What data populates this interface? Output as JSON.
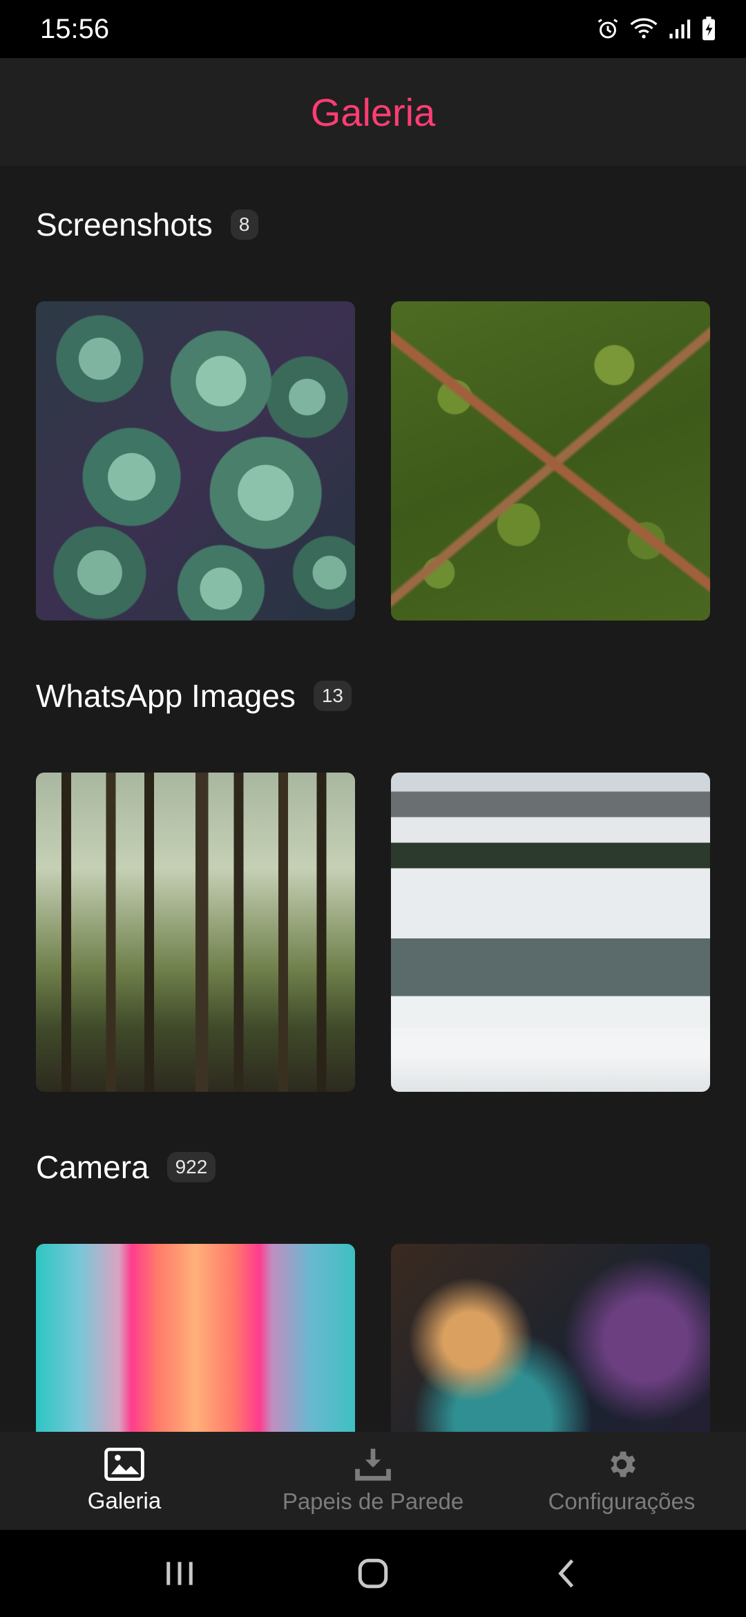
{
  "status_bar": {
    "time": "15:56",
    "icons": [
      "alarm-icon",
      "wifi-icon",
      "signal-icon",
      "battery-charging-icon"
    ]
  },
  "app_bar": {
    "title": "Galeria"
  },
  "sections": [
    {
      "title": "Screenshots",
      "count": "8",
      "thumbnails": [
        "succulents-photo",
        "aerial-forest-photo"
      ]
    },
    {
      "title": "WhatsApp Images",
      "count": "13",
      "thumbnails": [
        "forest-trees-photo",
        "mountain-lake-photo"
      ]
    },
    {
      "title": "Camera",
      "count": "922",
      "thumbnails": [
        "neon-corridor-photo",
        "nebula-photo"
      ]
    }
  ],
  "bottom_nav": {
    "items": [
      {
        "label": "Galeria",
        "icon": "image-icon",
        "active": true
      },
      {
        "label": "Papeis de Parede",
        "icon": "download-icon",
        "active": false
      },
      {
        "label": "Configurações",
        "icon": "gear-icon",
        "active": false
      }
    ]
  },
  "system_nav": [
    "recents-icon",
    "home-icon",
    "back-icon"
  ],
  "colors": {
    "accent": "#ff3d73",
    "background": "#1a1a1a",
    "bar": "#202020"
  }
}
